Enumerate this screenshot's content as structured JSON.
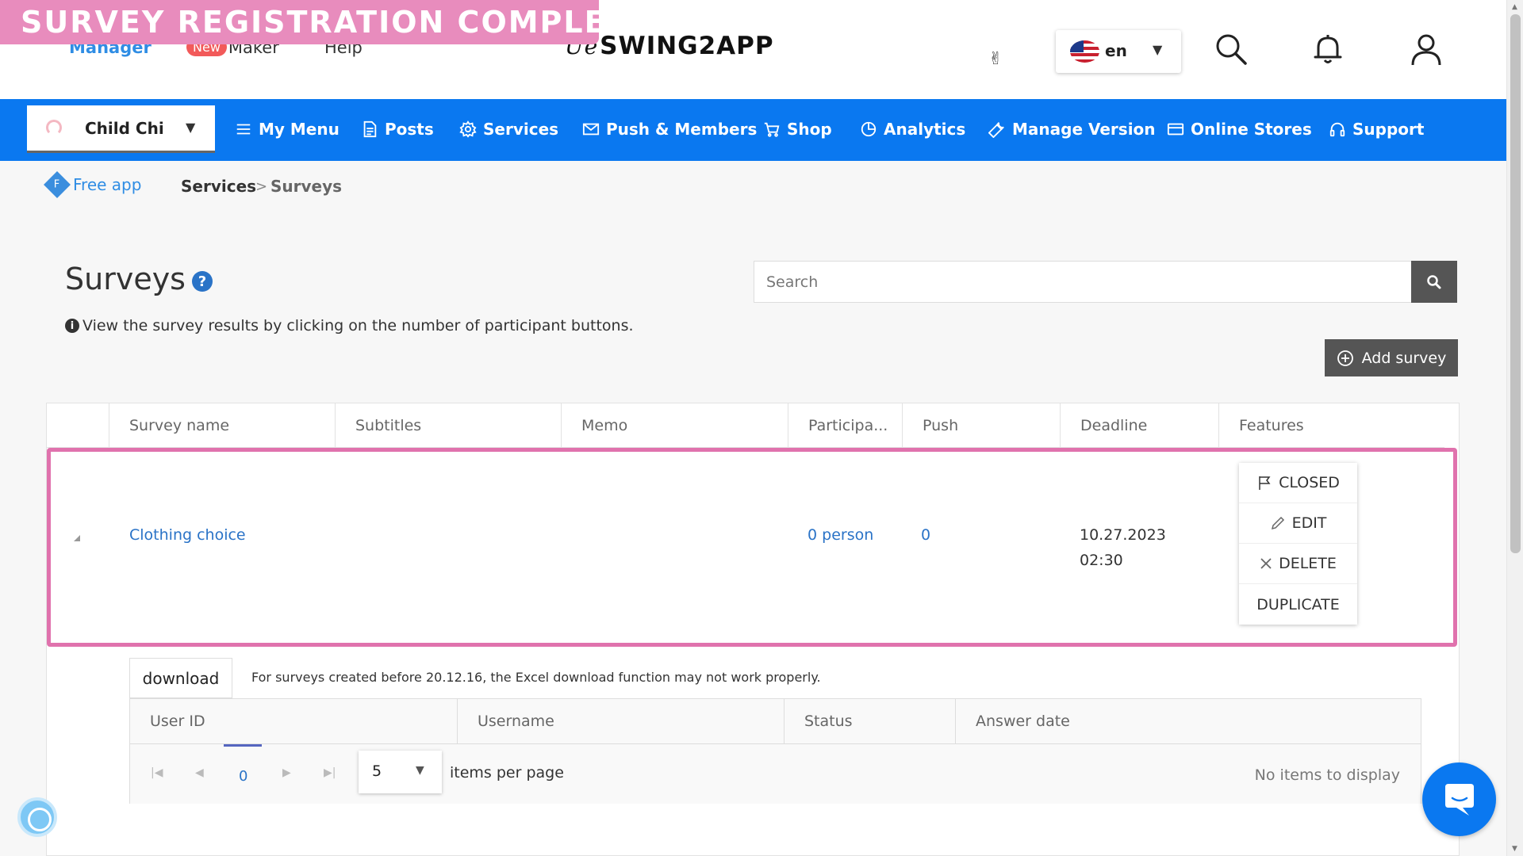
{
  "banner": {
    "text": "SURVEY REGISTRATION COMPLETION",
    "color": "#e88cbd"
  },
  "header": {
    "nav": {
      "manager": "Manager",
      "new_badge": "New",
      "maker": "Maker",
      "help": "Help"
    },
    "brand": {
      "swirl": "Ue",
      "name": "SWING2APP"
    },
    "language": {
      "code": "en",
      "flag": "us-flag"
    },
    "icons": [
      "hand-icon",
      "search-icon",
      "bell-icon",
      "user-icon"
    ]
  },
  "blue_nav": {
    "color": "#0a78f0",
    "app_name": "Child Chi",
    "items": [
      {
        "label": "My Menu",
        "icon": "hamburger-icon"
      },
      {
        "label": "Posts",
        "icon": "document-icon"
      },
      {
        "label": "Services",
        "icon": "gear-icon"
      },
      {
        "label": "Push & Members",
        "icon": "envelope-icon"
      },
      {
        "label": "Shop",
        "icon": "cart-icon"
      },
      {
        "label": "Analytics",
        "icon": "pie-chart-icon"
      },
      {
        "label": "Manage Version",
        "icon": "wrench-icon"
      },
      {
        "label": "Online Stores",
        "icon": "card-icon"
      },
      {
        "label": "Support",
        "icon": "headset-icon"
      }
    ]
  },
  "breadcrumb": {
    "plan_letter": "F",
    "plan": "Free app",
    "section": "Services",
    "separator": ">",
    "page": "Surveys"
  },
  "page": {
    "title": "Surveys",
    "help_mark": "?",
    "info_mark": "i",
    "info": "View the survey results by clicking on the number of participant buttons.",
    "search_placeholder": "Search",
    "add_button": "Add survey"
  },
  "grid": {
    "columns": [
      "Survey name",
      "Subtitles",
      "Memo",
      "Participa...",
      "Push",
      "Deadline",
      "Features"
    ],
    "rows": [
      {
        "survey_name": "Clothing choice",
        "subtitles": "",
        "memo": "",
        "participants": "0 person",
        "push": "0",
        "deadline_date": "10.27.2023",
        "deadline_time": "02:30",
        "features": [
          "CLOSED",
          "EDIT",
          "DELETE",
          "DUPLICATE"
        ]
      }
    ],
    "highlight_color": "#e072ad"
  },
  "detail": {
    "download_button": "download",
    "note": "For surveys created before 20.12.16, the Excel download function may not work properly.",
    "columns": [
      "User ID",
      "Username",
      "Status",
      "Answer date"
    ],
    "pager": {
      "current_page": "0",
      "page_size": "5",
      "items_per_page_label": "items per page",
      "empty_text": "No items to display"
    }
  }
}
